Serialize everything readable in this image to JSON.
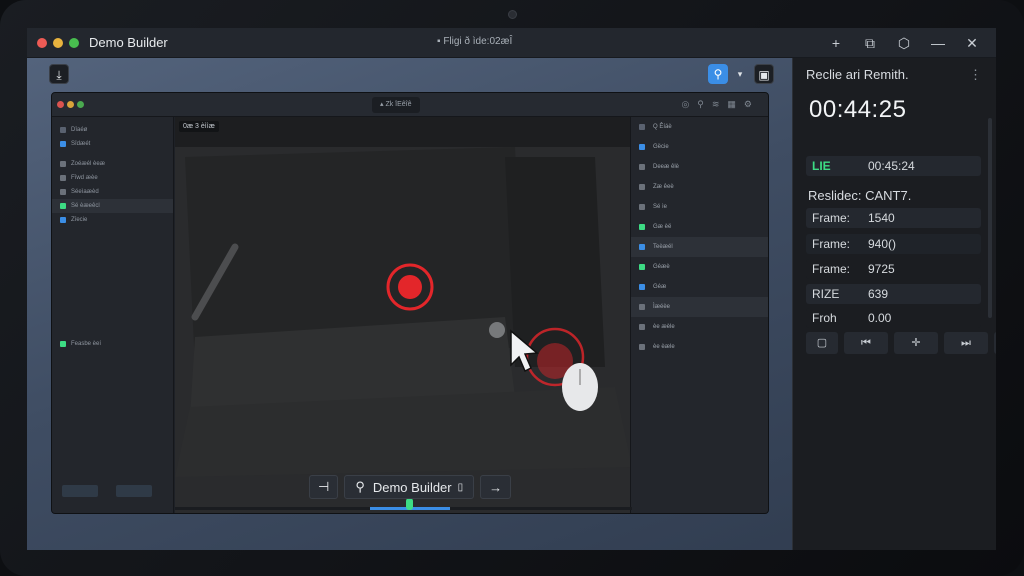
{
  "window": {
    "app_title": "Demo Builder",
    "doc_title": "▪ Fligi ð  ìde:02æÎ"
  },
  "inner_app": {
    "toolbar_center": "▴ Zk îEêîê",
    "left_panel_rows": [
      "Dîaéø",
      "Sîdæét",
      "Zoéæél èeæ",
      "Fîwd æèe",
      "Séeìaæèd",
      "Sé èæeêcl",
      "Zîecie",
      "Feasbe èeí"
    ],
    "viewport_label": "0æ 3 èììæ",
    "right_panel_rows": [
      "Q Êíáè",
      "Gëcie",
      "Deeæ êlè",
      "Zæ êeè",
      "Sé ìe",
      "Gæ èë",
      "Teèæél",
      "Géæè",
      "Géæ",
      "Ìæéèe",
      "èe æèle",
      "èe èæle"
    ]
  },
  "bottom_bar": {
    "search_label": "Demo Builder"
  },
  "side_panel": {
    "title": "Reclie ari Remith.",
    "timer": "00:44:25",
    "status_badge": "LIE",
    "status_time": "00:45:24",
    "subtitle": "Reslidec: CANT7.",
    "fields": [
      {
        "label": "Frame:",
        "value": "1540"
      },
      {
        "label": "Frame:",
        "value": "940()"
      },
      {
        "label": "Frame:",
        "value": "9725"
      },
      {
        "label": "RIZE",
        "value": "639"
      },
      {
        "label": "Froh",
        "value": "0.00"
      }
    ]
  },
  "colors": {
    "accent_blue": "#3b8ee6",
    "record_red": "#e3262a",
    "status_green": "#3ddc84",
    "panel_bg": "#1b1d21"
  },
  "icons": [
    "plus-icon",
    "copy-icon",
    "gear-icon",
    "minimize-icon",
    "close-icon",
    "search-icon",
    "chevron-down-icon",
    "square-icon",
    "more-icon"
  ]
}
